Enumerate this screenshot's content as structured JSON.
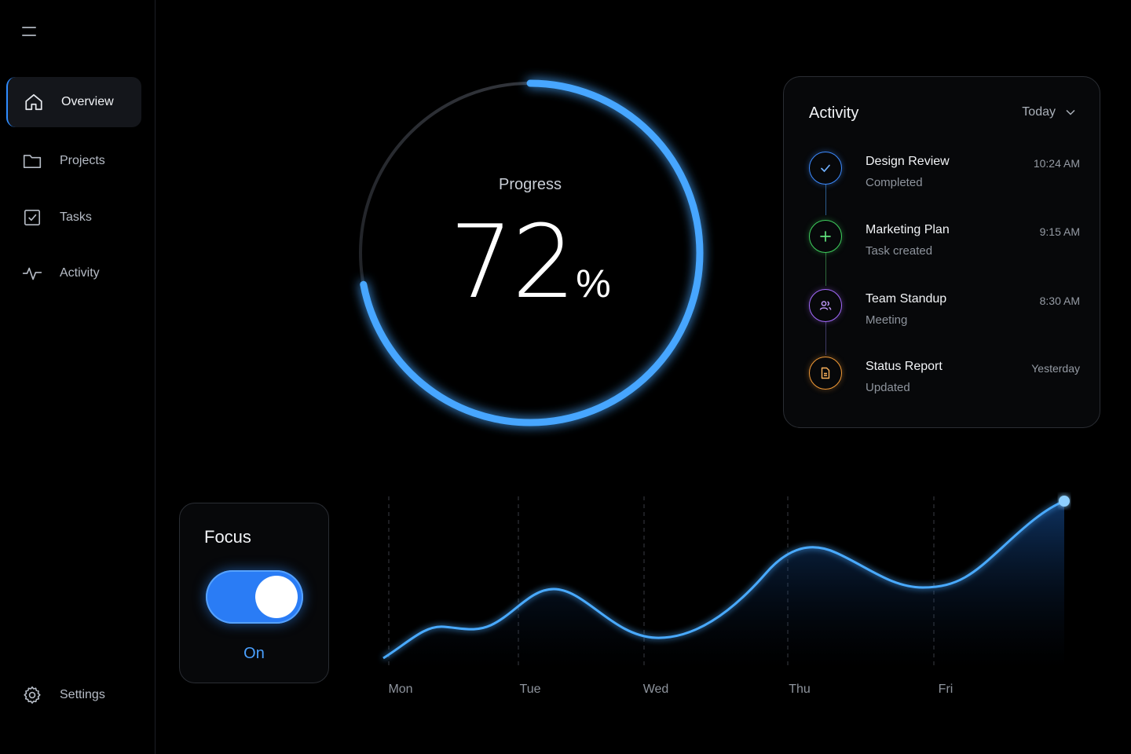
{
  "sidebar": {
    "items": [
      {
        "label": "Overview",
        "icon": "home-icon",
        "active": true
      },
      {
        "label": "Projects",
        "icon": "folder-icon",
        "active": false
      },
      {
        "label": "Tasks",
        "icon": "checkbox-icon",
        "active": false
      },
      {
        "label": "Activity",
        "icon": "pulse-icon",
        "active": false
      }
    ],
    "settings_label": "Settings"
  },
  "progress": {
    "label": "Progress",
    "value": "72",
    "unit": "%",
    "fraction": 0.72
  },
  "activity": {
    "title": "Activity",
    "filter": "Today",
    "items": [
      {
        "name": "Design Review",
        "status": "Completed",
        "time": "10:24 AM",
        "icon": "check-icon",
        "color": "#3d8bff"
      },
      {
        "name": "Marketing Plan",
        "status": "Task created",
        "time": "9:15 AM",
        "icon": "plus-icon",
        "color": "#3fd15e"
      },
      {
        "name": "Team Standup",
        "status": "Meeting",
        "time": "8:30 AM",
        "icon": "users-icon",
        "color": "#a56bff"
      },
      {
        "name": "Status Report",
        "status": "Updated",
        "time": "Yesterday",
        "icon": "document-icon",
        "color": "#f29a36"
      }
    ]
  },
  "focus": {
    "title": "Focus",
    "state": "On",
    "enabled": true
  },
  "chart_data": {
    "type": "area",
    "x": [
      "Mon",
      "Tue",
      "Wed",
      "Thu",
      "Fri"
    ],
    "color": "#3aa0ff"
  }
}
